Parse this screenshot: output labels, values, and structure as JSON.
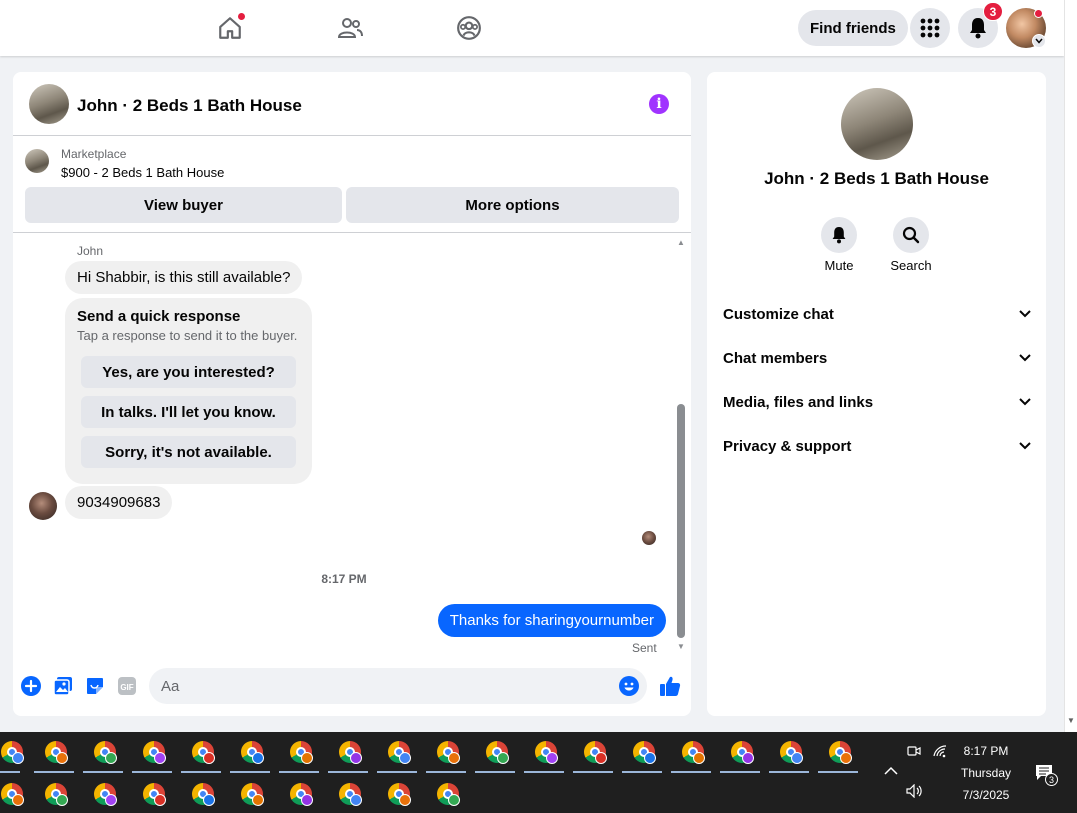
{
  "topbar": {
    "nav": [
      "home-icon",
      "friends-icon",
      "groups-icon"
    ],
    "find_friends_label": "Find friends",
    "notification_count": "3",
    "colors": {
      "accent": "#0866ff",
      "badge": "#e41e3f"
    }
  },
  "chat": {
    "title": "John · 2 Beds 1 Bath House",
    "marketplace_label": "Marketplace",
    "marketplace_item": "$900 - 2 Beds 1 Bath House",
    "view_buyer_label": "View buyer",
    "more_options_label": "More options",
    "sender_name": "John",
    "incoming_message": "Hi Shabbir, is this still available?",
    "quick_response": {
      "title": "Send a quick response",
      "subtitle": "Tap a response to send it to the buyer.",
      "options": [
        "Yes, are you interested?",
        "In talks. I'll let you know.",
        "Sorry, it's not available."
      ]
    },
    "incoming_number": "9034909683",
    "timestamp": "8:17 PM",
    "outgoing_message": "Thanks for sharingyournumber",
    "sent_label": "Sent",
    "composer_placeholder": "Aa",
    "composer_gif_label": "GIF"
  },
  "info_panel": {
    "name": "John · 2 Beds 1 Bath House",
    "actions": [
      {
        "label": "Mute",
        "icon": "bell-icon"
      },
      {
        "label": "Search",
        "icon": "search-icon"
      }
    ],
    "sections": [
      "Customize chat",
      "Chat members",
      "Media, files and links",
      "Privacy & support"
    ]
  },
  "taskbar": {
    "time": "8:17 PM",
    "day": "Thursday",
    "date": "7/3/2025",
    "notification_count": "3"
  }
}
